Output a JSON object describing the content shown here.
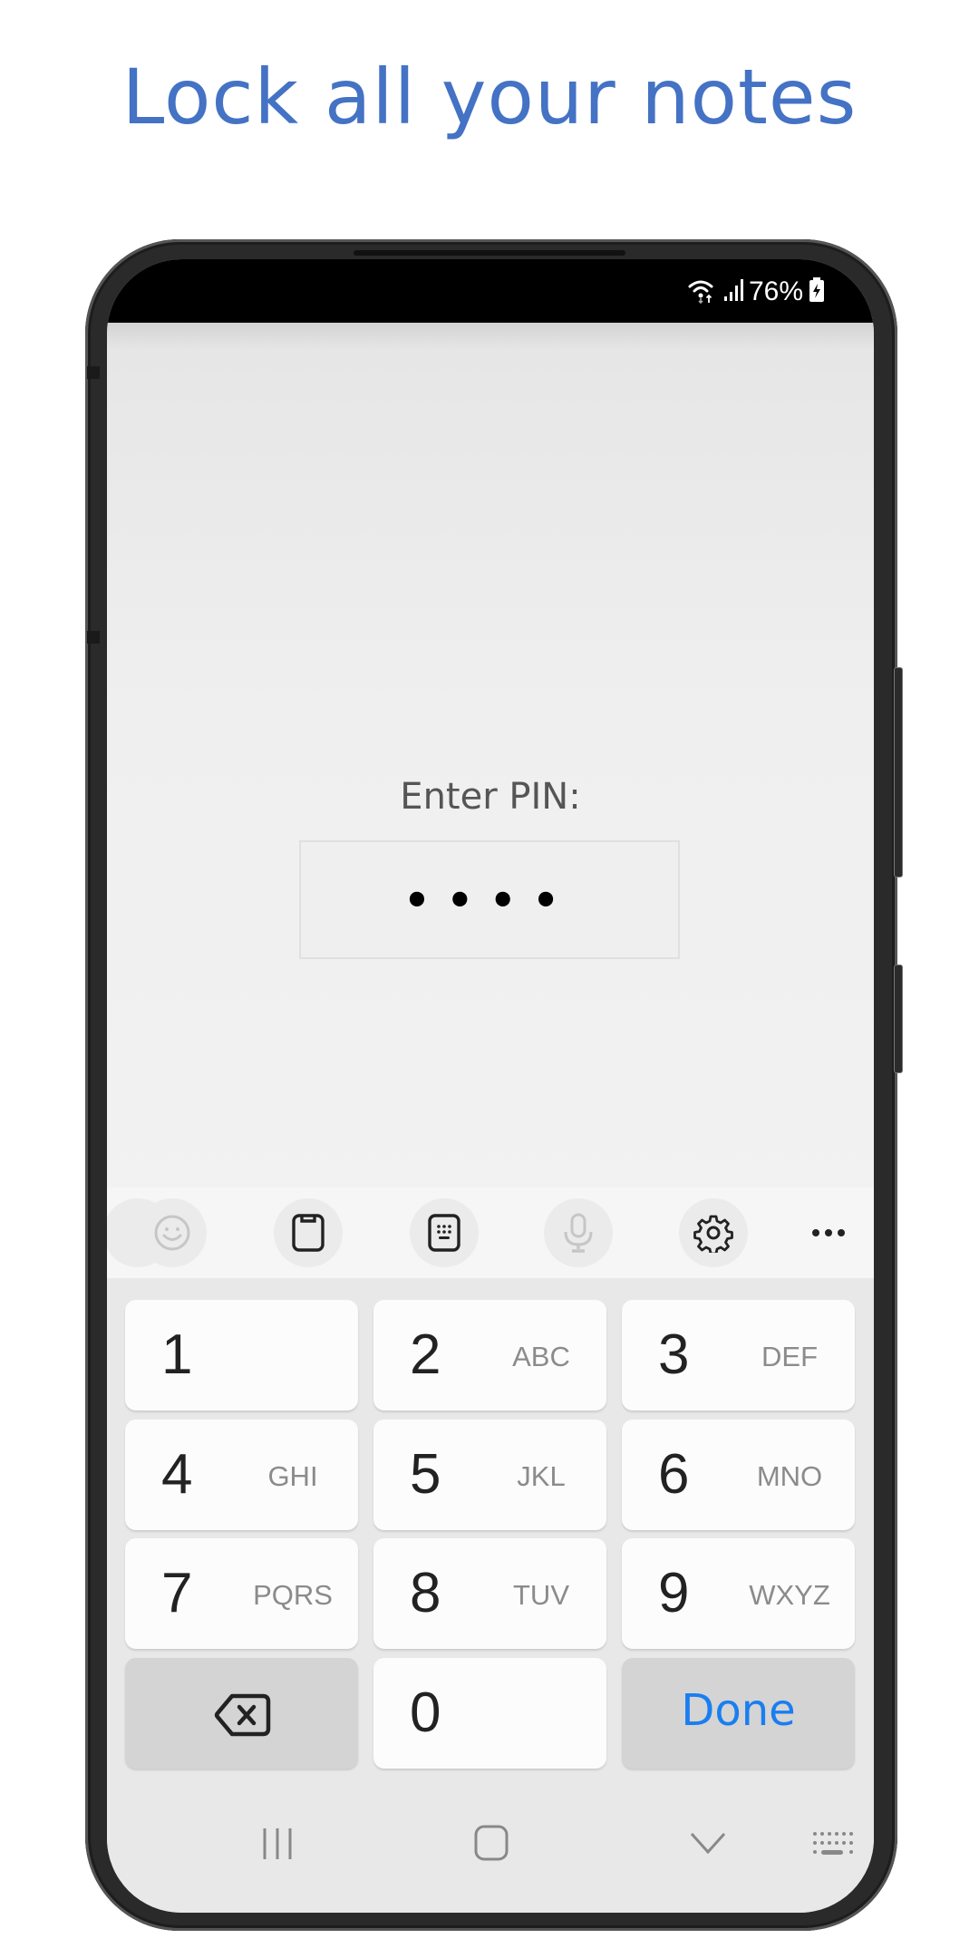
{
  "headline": "Lock all your notes",
  "status_bar": {
    "icons": [
      "wifi-data-icon",
      "signal-icon",
      "battery-charging-icon"
    ],
    "battery_percent": "76%"
  },
  "pin_screen": {
    "label": "Enter PIN:",
    "pin_value": "••••",
    "pin_length": 4
  },
  "keyboard_toolbar": [
    {
      "icon": "emoji-icon",
      "enabled": false
    },
    {
      "icon": "clipboard-icon",
      "enabled": true
    },
    {
      "icon": "keyboard-mode-icon",
      "enabled": true
    },
    {
      "icon": "microphone-icon",
      "enabled": false
    },
    {
      "icon": "settings-gear-icon",
      "enabled": true
    },
    {
      "icon": "more-options-icon",
      "enabled": true
    }
  ],
  "keypad": {
    "keys": [
      {
        "digit": "1",
        "letters": ""
      },
      {
        "digit": "2",
        "letters": "ABC"
      },
      {
        "digit": "3",
        "letters": "DEF"
      },
      {
        "digit": "4",
        "letters": "GHI"
      },
      {
        "digit": "5",
        "letters": "JKL"
      },
      {
        "digit": "6",
        "letters": "MNO"
      },
      {
        "digit": "7",
        "letters": "PQRS"
      },
      {
        "digit": "8",
        "letters": "TUV"
      },
      {
        "digit": "9",
        "letters": "WXYZ"
      },
      {
        "digit": "0",
        "letters": ""
      }
    ],
    "backspace_icon": "backspace-icon",
    "done_label": "Done"
  },
  "nav_bar": [
    "recent-apps-icon",
    "home-icon",
    "hide-keyboard-icon",
    "keyboard-switch-icon"
  ],
  "colors": {
    "headline": "#4472C4",
    "done": "#1A7EF0",
    "status_bar": "#000000"
  }
}
